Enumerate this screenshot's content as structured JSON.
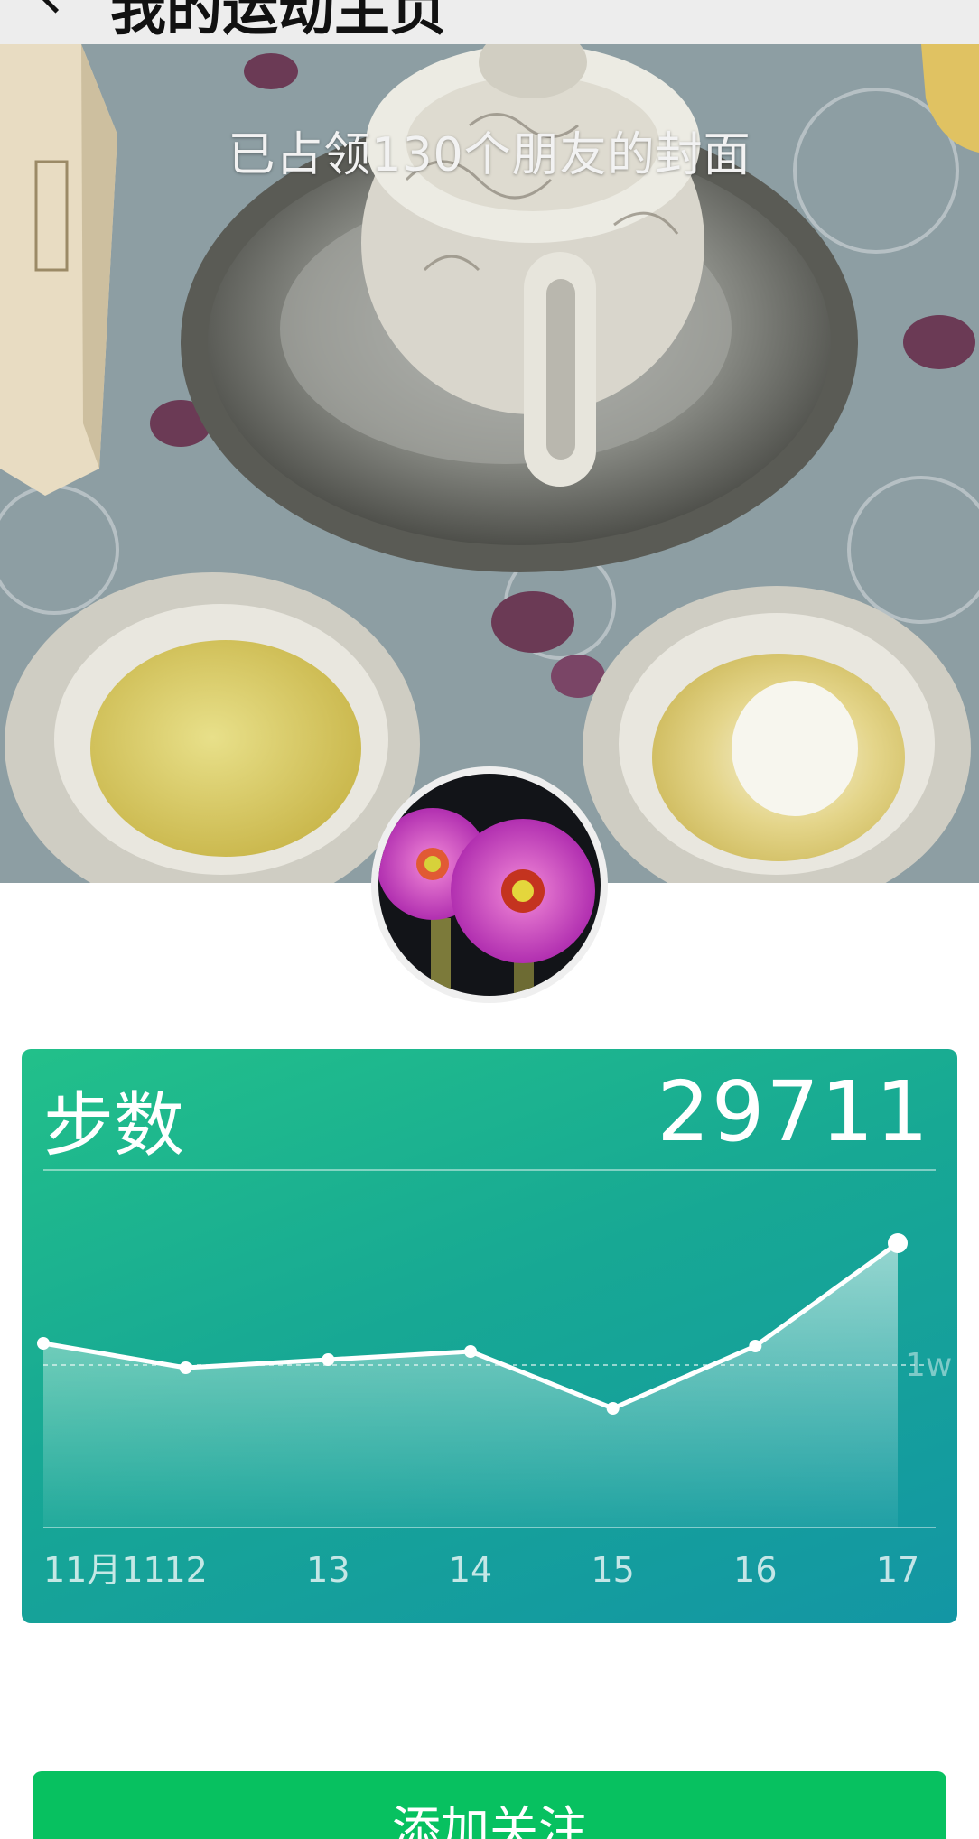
{
  "header": {
    "title": "我的运动主页"
  },
  "cover": {
    "occupied_text": "已占领130个朋友的封面"
  },
  "steps_card": {
    "label": "步数",
    "total": "29711",
    "ref_line_label": "1w"
  },
  "chart_data": {
    "type": "area",
    "categories": [
      "11月11",
      "12",
      "13",
      "14",
      "15",
      "16",
      "17"
    ],
    "series": [
      {
        "values": [
          10800,
          9900,
          10200,
          10500,
          8400,
          10700,
          14500
        ]
      }
    ],
    "reference_line": {
      "value": 10000,
      "label": "1w"
    },
    "ylim": [
      4000,
      16000
    ]
  },
  "actions": {
    "follow_label": "添加关注"
  },
  "colors": {
    "card_start": "#22c08a",
    "card_end": "#1396a4",
    "button": "#07c160",
    "topbar": "#ededed"
  },
  "icons": {
    "back": "back-arrow-icon"
  }
}
